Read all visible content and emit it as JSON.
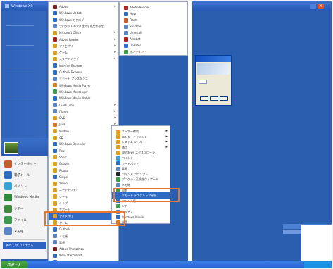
{
  "desktop": {
    "title": "Windows XP",
    "close_glyph": "×"
  },
  "start_panel": {
    "items": [
      {
        "label": "インターネット",
        "icon_color": "#c85a2a"
      },
      {
        "label": "電子メール",
        "icon_color": "#2d6dc6"
      },
      {
        "label": "ペイント",
        "icon_color": "#3aa0d8"
      },
      {
        "label": "Windows Media",
        "icon_color": "#2f8a3c"
      },
      {
        "label": "ツアー",
        "icon_color": "#3c8a3c"
      },
      {
        "label": "ファイル",
        "icon_color": "#3b9b4c"
      },
      {
        "label": "メモ帳",
        "icon_color": "#5a86c8"
      }
    ],
    "all_programs": "すべてのプログラム"
  },
  "programs_menu": {
    "items": [
      {
        "label": "Adobe",
        "arrow": "▸",
        "icon_color": "#7b1a1a"
      },
      {
        "label": "Windows Update",
        "arrow": "",
        "icon_color": "#2d6dc6"
      },
      {
        "label": "Windows カタログ",
        "arrow": "",
        "icon_color": "#2d6dc6"
      },
      {
        "label": "プログラムのアクセスと既定の設定",
        "arrow": "",
        "icon_color": "#5a86c8"
      },
      {
        "label": "Microsoft Office",
        "arrow": "▸",
        "icon_color": "#e0a020"
      },
      {
        "label": "Adobe Reader",
        "arrow": "▸",
        "icon_color": "#b0221c"
      },
      {
        "label": "アクセサリ",
        "arrow": "▸",
        "icon_color": "#e0a020"
      },
      {
        "label": "ゲーム",
        "arrow": "▸",
        "icon_color": "#e0a020"
      },
      {
        "label": "スタートアップ",
        "arrow": "▸",
        "icon_color": "#e0a020"
      },
      {
        "label": "Internet Explorer",
        "arrow": "",
        "icon_color": "#2d6dc6"
      },
      {
        "label": "Outlook Express",
        "arrow": "",
        "icon_color": "#2d6dc6"
      },
      {
        "label": "リモート アシスタンス",
        "arrow": "",
        "icon_color": "#5a86c8"
      },
      {
        "label": "Windows Media Player",
        "arrow": "",
        "icon_color": "#e07a20"
      },
      {
        "label": "Windows Messenger",
        "arrow": "",
        "icon_color": "#3b9b4c"
      },
      {
        "label": "Windows Movie Maker",
        "arrow": "",
        "icon_color": "#2d6dc6"
      },
      {
        "label": "QuickTime",
        "arrow": "▸",
        "icon_color": "#5a86c8"
      },
      {
        "label": "iTunes",
        "arrow": "▸",
        "icon_color": "#5a86c8"
      },
      {
        "label": "DVD",
        "arrow": "▸",
        "icon_color": "#e0a020"
      },
      {
        "label": "Java",
        "arrow": "▸",
        "icon_color": "#e07a20"
      },
      {
        "label": "Norton",
        "arrow": "▸",
        "icon_color": "#e0a020"
      },
      {
        "label": "CD",
        "arrow": "▸",
        "icon_color": "#e0a020"
      },
      {
        "label": "Windows Defender",
        "arrow": "▸",
        "icon_color": "#2d6dc6"
      },
      {
        "label": "Real",
        "arrow": "▸",
        "icon_color": "#2d6dc6"
      },
      {
        "label": "Sonic",
        "arrow": "▸",
        "icon_color": "#e0a020"
      },
      {
        "label": "Google",
        "arrow": "▸",
        "icon_color": "#e0a020"
      },
      {
        "label": "Picasa",
        "arrow": "▸",
        "icon_color": "#e0a020"
      },
      {
        "label": "Skype",
        "arrow": "▸",
        "icon_color": "#2d6dc6"
      },
      {
        "label": "Yahoo!",
        "arrow": "▸",
        "icon_color": "#e0a020"
      },
      {
        "label": "ユーティリティ",
        "arrow": "▸",
        "icon_color": "#e0a020"
      },
      {
        "label": "ツール",
        "arrow": "▸",
        "icon_color": "#e0a020"
      },
      {
        "label": "ヘルプ",
        "arrow": "▸",
        "icon_color": "#e0a020"
      },
      {
        "label": "サポート",
        "arrow": "▸",
        "icon_color": "#e0a020"
      },
      {
        "label": "アクセサリ",
        "arrow": "▸",
        "icon_color": "#e0a020",
        "highlight": true
      },
      {
        "label": "ゲーム",
        "arrow": "",
        "icon_color": "#e0a020"
      },
      {
        "label": "Outlook",
        "arrow": "",
        "icon_color": "#2d6dc6"
      },
      {
        "label": "メモ帳",
        "arrow": "",
        "icon_color": "#5a86c8"
      },
      {
        "label": "電卓",
        "arrow": "",
        "icon_color": "#5a86c8"
      },
      {
        "label": "Adobe Photoshop",
        "arrow": "",
        "icon_color": "#7b1a1a"
      },
      {
        "label": "Nero StartSmart",
        "arrow": "",
        "icon_color": "#2d6dc6"
      },
      {
        "label": "Windows Movie Maker",
        "arrow": "",
        "icon_color": "#2d6dc6"
      }
    ]
  },
  "top_submenu": {
    "items": [
      {
        "label": "Adobe Reader",
        "icon_color": "#b0221c"
      },
      {
        "label": "Help",
        "icon_color": "#2d6dc6"
      },
      {
        "label": "Flash",
        "icon_color": "#c85a2a"
      },
      {
        "label": "Readme",
        "icon_color": "#5a86c8"
      },
      {
        "label": "Uninstall",
        "icon_color": "#5a86c8"
      },
      {
        "label": "Acrobat",
        "icon_color": "#b0221c"
      },
      {
        "label": "Updater",
        "icon_color": "#2d6dc6"
      },
      {
        "label": "オンライン",
        "icon_color": "#3b9b4c"
      }
    ]
  },
  "accessories_submenu": {
    "items": [
      {
        "label": "ユーザー補助",
        "arrow": "▸",
        "icon_color": "#e0a020"
      },
      {
        "label": "エンターテイメント",
        "arrow": "▸",
        "icon_color": "#e0a020"
      },
      {
        "label": "システム ツール",
        "arrow": "▸",
        "icon_color": "#e0a020"
      },
      {
        "label": "通信",
        "arrow": "▸",
        "icon_color": "#e0a020"
      },
      {
        "label": "Windows エクスプローラ",
        "arrow": "",
        "icon_color": "#e0a020"
      },
      {
        "label": "ペイント",
        "arrow": "",
        "icon_color": "#3aa0d8"
      },
      {
        "label": "ワードパッド",
        "arrow": "",
        "icon_color": "#2d6dc6"
      },
      {
        "label": "電卓",
        "arrow": "",
        "icon_color": "#5a86c8"
      },
      {
        "label": "コマンド プロンプト",
        "arrow": "",
        "icon_color": "#222222"
      },
      {
        "label": "プログラム互換性ウィザード",
        "arrow": "",
        "icon_color": "#3b9b4c"
      },
      {
        "label": "メモ帳",
        "arrow": "",
        "icon_color": "#5a86c8"
      },
      {
        "label": "同期",
        "arrow": "",
        "icon_color": "#3b9b4c"
      },
      {
        "label": "リモート デスクトップ接続",
        "arrow": "",
        "icon_color": "#2d6dc6",
        "highlight": true
      },
      {
        "label": "アドレス帳",
        "arrow": "",
        "icon_color": "#2d6dc6"
      },
      {
        "label": "ツアー",
        "arrow": "",
        "icon_color": "#3b9b4c"
      },
      {
        "label": "スキャナ",
        "arrow": "",
        "icon_color": "#5a86c8"
      },
      {
        "label": "Windows Movie",
        "arrow": "",
        "icon_color": "#2d6dc6"
      },
      {
        "label": "録音",
        "arrow": "",
        "icon_color": "#e07a20"
      }
    ]
  },
  "taskbar": {
    "start_label": "スタート"
  }
}
